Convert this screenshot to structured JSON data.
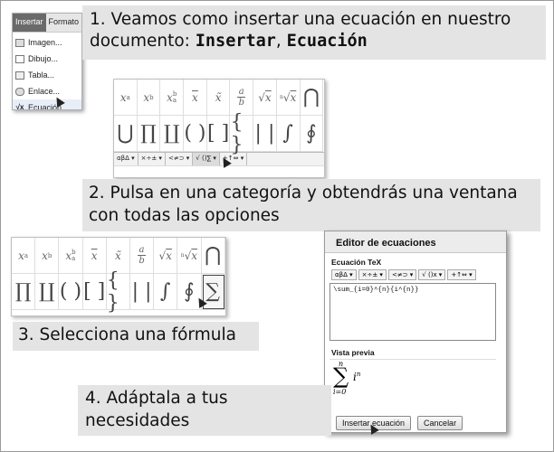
{
  "menu": {
    "tabs": [
      "Insertar",
      "Formato"
    ],
    "items": [
      {
        "label": "Imagen...",
        "icon": "image-icon"
      },
      {
        "label": "Dibujo...",
        "icon": "drawing-icon"
      },
      {
        "label": "Tabla...",
        "icon": "table-icon"
      },
      {
        "label": "Enlace...",
        "icon": "link-icon"
      },
      {
        "label": "Ecuación...",
        "icon": "equation-icon"
      }
    ]
  },
  "steps": {
    "step1_line1": "1. Veamos como insertar una ecuación en nuestro",
    "step1_line2_prefix": "documento: ",
    "step1_insertar": "Insertar",
    "step1_sep": ", ",
    "step1_ecuacion": "Ecuación",
    "step2_line1": "2. Pulsa en una categoría y obtendrás una ventana",
    "step2_line2": "con todas las opciones",
    "step3": "3. Selecciona una fórmula",
    "step4_line1": "4. Adáptala a tus",
    "step4_line2": "necesidades"
  },
  "palette": {
    "categories": [
      "αβΔ ▾",
      "×÷± ▾",
      "<≠⊃ ▾",
      "√ ()∑ ▾",
      "+↑⇔ ▾"
    ]
  },
  "editor": {
    "title": "Editor de ecuaciones",
    "tex_label": "Ecuación TeX",
    "categories": [
      "αβΔ ▾",
      "×÷± ▾",
      "<≠⊃ ▾",
      "√ ()x ▾",
      "+↑⇔ ▾"
    ],
    "tex_value": "\\sum_{i=0}^{n}{i^{n}}",
    "preview_label": "Vista previa",
    "insert_button": "Insertar ecuación",
    "cancel_button": "Cancelar"
  }
}
